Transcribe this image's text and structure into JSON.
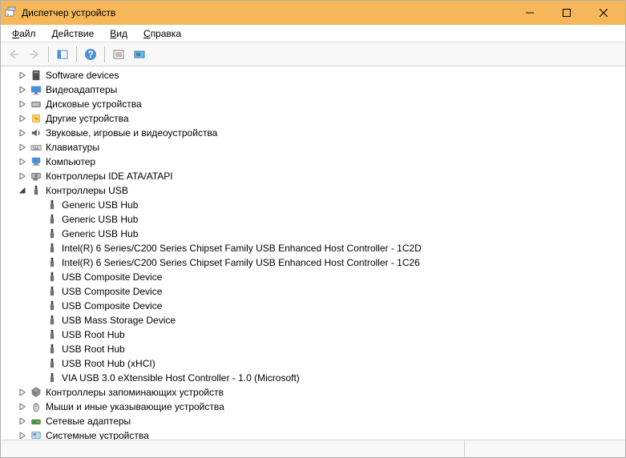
{
  "window": {
    "title": "Диспетчер устройств"
  },
  "menu": {
    "file": "Файл",
    "action": "Действие",
    "view": "Вид",
    "help": "Справка"
  },
  "toolbar": {
    "back": "back",
    "forward": "forward",
    "show_hide": "show-hide",
    "help": "help",
    "properties": "properties",
    "scan": "scan"
  },
  "tree": [
    {
      "level": 0,
      "expanded": false,
      "icon": "software",
      "label": "Software devices"
    },
    {
      "level": 0,
      "expanded": false,
      "icon": "display",
      "label": "Видеоадаптеры"
    },
    {
      "level": 0,
      "expanded": false,
      "icon": "disk",
      "label": "Дисковые устройства"
    },
    {
      "level": 0,
      "expanded": false,
      "icon": "other",
      "label": "Другие устройства"
    },
    {
      "level": 0,
      "expanded": false,
      "icon": "sound",
      "label": "Звуковые, игровые и видеоустройства"
    },
    {
      "level": 0,
      "expanded": false,
      "icon": "keyboard",
      "label": "Клавиатуры"
    },
    {
      "level": 0,
      "expanded": false,
      "icon": "computer",
      "label": "Компьютер"
    },
    {
      "level": 0,
      "expanded": false,
      "icon": "ide",
      "label": "Контроллеры IDE ATA/ATAPI"
    },
    {
      "level": 0,
      "expanded": true,
      "icon": "usb",
      "label": "Контроллеры USB"
    },
    {
      "level": 1,
      "expanded": null,
      "icon": "usb",
      "label": "Generic USB Hub"
    },
    {
      "level": 1,
      "expanded": null,
      "icon": "usb",
      "label": "Generic USB Hub"
    },
    {
      "level": 1,
      "expanded": null,
      "icon": "usb",
      "label": "Generic USB Hub"
    },
    {
      "level": 1,
      "expanded": null,
      "icon": "usb",
      "label": "Intel(R) 6 Series/C200 Series Chipset Family USB Enhanced Host Controller - 1C2D"
    },
    {
      "level": 1,
      "expanded": null,
      "icon": "usb",
      "label": "Intel(R) 6 Series/C200 Series Chipset Family USB Enhanced Host Controller - 1C26"
    },
    {
      "level": 1,
      "expanded": null,
      "icon": "usb",
      "label": "USB Composite Device"
    },
    {
      "level": 1,
      "expanded": null,
      "icon": "usb",
      "label": "USB Composite Device"
    },
    {
      "level": 1,
      "expanded": null,
      "icon": "usb",
      "label": "USB Composite Device"
    },
    {
      "level": 1,
      "expanded": null,
      "icon": "usb",
      "label": "USB Mass Storage Device"
    },
    {
      "level": 1,
      "expanded": null,
      "icon": "usb",
      "label": "USB Root Hub"
    },
    {
      "level": 1,
      "expanded": null,
      "icon": "usb",
      "label": "USB Root Hub"
    },
    {
      "level": 1,
      "expanded": null,
      "icon": "usb",
      "label": "USB Root Hub (xHCI)"
    },
    {
      "level": 1,
      "expanded": null,
      "icon": "usb",
      "label": "VIA USB 3.0 eXtensible Host Controller - 1.0 (Microsoft)"
    },
    {
      "level": 0,
      "expanded": false,
      "icon": "storage",
      "label": "Контроллеры запоминающих устройств"
    },
    {
      "level": 0,
      "expanded": false,
      "icon": "mouse",
      "label": "Мыши и иные указывающие устройства"
    },
    {
      "level": 0,
      "expanded": false,
      "icon": "network",
      "label": "Сетевые адаптеры"
    },
    {
      "level": 0,
      "expanded": false,
      "icon": "system",
      "label": "Системные устройства"
    }
  ],
  "icons_svg": {
    "software": "<svg width='14' height='14' viewBox='0 0 16 16'><rect x='3' y='1' width='10' height='14' fill='#505050' rx='1'/><rect x='5' y='3' width='6' height='2' fill='#a0a0a0'/></svg>",
    "display": "<svg width='14' height='14' viewBox='0 0 16 16'><rect x='1' y='3' width='14' height='9' fill='#4a90d9' rx='1'/><rect x='6' y='12' width='4' height='2' fill='#808080'/><rect x='4' y='14' width='8' height='1' fill='#808080'/></svg>",
    "disk": "<svg width='14' height='14' viewBox='0 0 16 16'><rect x='2' y='5' width='12' height='7' fill='#c0c0c0' stroke='#606060' rx='1'/><circle cx='12' cy='8.5' r='1' fill='#4a90d9'/></svg>",
    "other": "<svg width='14' height='14' viewBox='0 0 16 16'><rect x='3' y='3' width='10' height='10' fill='#ffd966' stroke='#d0a030'/><path d='M5 7 L7 5 L11 9 L9 11 Z' fill='#d0a030'/></svg>",
    "sound": "<svg width='14' height='14' viewBox='0 0 16 16'><path d='M2 6 L5 6 L9 3 L9 13 L5 10 L2 10 Z' fill='#606060'/><path d='M11 5 Q14 8 11 11' stroke='#606060' fill='none' stroke-width='1.5'/></svg>",
    "keyboard": "<svg width='14' height='14' viewBox='0 0 16 16'><rect x='1' y='5' width='14' height='7' fill='#e0e0e0' stroke='#808080' rx='1'/><rect x='3' y='7' width='2' height='1.5' fill='#808080'/><rect x='6' y='7' width='2' height='1.5' fill='#808080'/><rect x='9' y='7' width='2' height='1.5' fill='#808080'/><rect x='4' y='9.5' width='8' height='1.5' fill='#808080'/></svg>",
    "computer": "<svg width='14' height='14' viewBox='0 0 16 16'><rect x='2' y='2' width='12' height='8' fill='#4a90d9' rx='1'/><rect x='5' y='10' width='6' height='2' fill='#808080'/><rect x='3' y='12' width='10' height='1.5' fill='#a0a0a0'/></svg>",
    "ide": "<svg width='14' height='14' viewBox='0 0 16 16'><rect x='2' y='4' width='12' height='7' fill='#c0c0c0' stroke='#606060'/><circle cx='8' cy='7.5' r='2.5' fill='#808080'/><ellipse cx='7' cy='13' rx='4' ry='1.5' fill='#808080'/></svg>",
    "usb": "<svg width='14' height='14' viewBox='0 0 16 16'><rect x='6.5' y='1' width='3' height='5' fill='#404040'/><rect x='5.5' y='6' width='5' height='8' fill='#707070' rx='1'/></svg>",
    "storage": "<svg width='14' height='14' viewBox='0 0 16 16'><path d='M8 1 L14 5 L8 9 L2 5 Z' fill='#a0a0a0' stroke='#606060'/><path d='M2 5 L2 11 L8 15 L8 9 Z' fill='#808080'/><path d='M14 5 L14 11 L8 15 L8 9 Z' fill='#909090'/></svg>",
    "mouse": "<svg width='14' height='14' viewBox='0 0 16 16'><ellipse cx='8' cy='9' rx='4' ry='6' fill='#d0d0d0' stroke='#808080'/><line x1='8' y1='3' x2='8' y2='8' stroke='#808080'/></svg>",
    "network": "<svg width='14' height='14' viewBox='0 0 16 16'><rect x='2' y='6' width='12' height='6' fill='#5aa05a' stroke='#3a703a' rx='1'/><rect x='4' y='8' width='3' height='2' fill='#3a703a'/><circle cx='11' cy='9' r='1' fill='#ffcc00'/></svg>",
    "system": "<svg width='14' height='14' viewBox='0 0 16 16'><rect x='2' y='3' width='12' height='9' fill='#c0d8f0' stroke='#6090c0' rx='1'/><rect x='4' y='5' width='4' height='3' fill='#808080'/></svg>",
    "app": "<svg width='16' height='16' viewBox='0 0 16 16'><rect x='2' y='4' width='10' height='8' fill='#fff' stroke='#808080'/><rect x='5' y='1' width='9' height='4' fill='#c0d8f0' stroke='#808080'/><circle cx='5' cy='10' r='1' fill='#808080'/></svg>"
  }
}
